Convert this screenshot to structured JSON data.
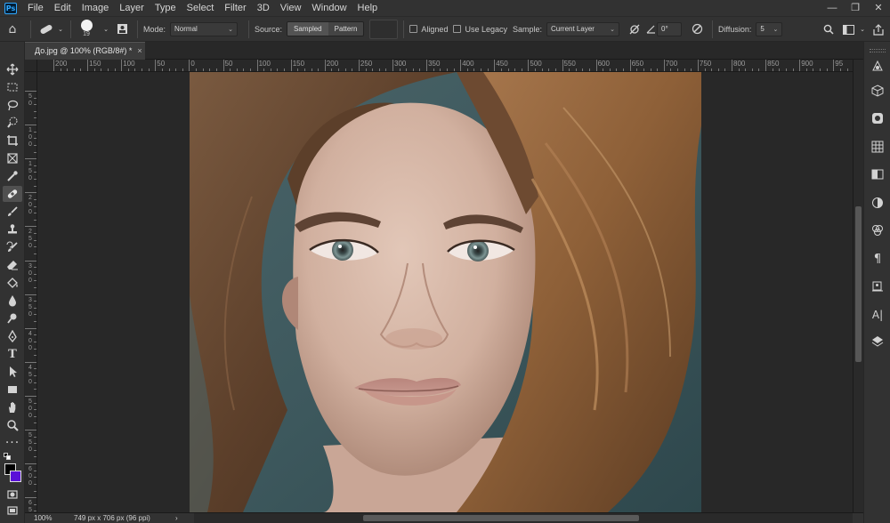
{
  "app": {
    "logo_text": "Ps"
  },
  "menu": [
    "File",
    "Edit",
    "Image",
    "Layer",
    "Type",
    "Select",
    "Filter",
    "3D",
    "View",
    "Window",
    "Help"
  ],
  "window_controls": {
    "minimize": "—",
    "restore": "❐",
    "close": "✕"
  },
  "options": {
    "brush_size": "19",
    "mode_label": "Mode:",
    "mode_value": "Normal",
    "source_label": "Source:",
    "source_sampled": "Sampled",
    "source_pattern": "Pattern",
    "aligned_label": "Aligned",
    "legacy_label": "Use Legacy",
    "sample_label": "Sample:",
    "sample_value": "Current Layer",
    "angle_value": "0°",
    "diffusion_label": "Diffusion:",
    "diffusion_value": "5"
  },
  "document_tab": {
    "title": "До.jpg @ 100% (RGB/8#) *",
    "close": "×"
  },
  "ruler_h": [
    "200",
    "150",
    "100",
    "50",
    "0",
    "50",
    "100",
    "150",
    "200",
    "250",
    "300",
    "350",
    "400",
    "450",
    "500",
    "550",
    "600",
    "650",
    "700",
    "750",
    "800",
    "850",
    "900",
    "95"
  ],
  "ruler_v": [
    "5 0",
    "1 0 0",
    "1 5 0",
    "2 0 0",
    "2 5 0",
    "3 0 0",
    "3 5 0",
    "4 0 0",
    "4 5 0",
    "5 0 0",
    "5 5 0",
    "6 0 0",
    "6 5"
  ],
  "status": {
    "zoom": "100%",
    "doc_info": "749 px x 706 px (96 ppi)",
    "arrow": "›"
  },
  "tools": [
    "move-icon",
    "marquee-icon",
    "lasso-icon",
    "quick-select-icon",
    "crop-icon",
    "frame-icon",
    "eyedropper-icon",
    "healing-brush-icon",
    "brush-icon",
    "clone-stamp-icon",
    "history-brush-icon",
    "eraser-icon",
    "paint-bucket-icon",
    "blur-icon",
    "dodge-icon",
    "pen-icon",
    "type-icon",
    "path-select-icon",
    "rectangle-icon",
    "hand-icon",
    "zoom-icon",
    "more-icon"
  ],
  "colors": {
    "foreground": "#000000",
    "background": "#5a10d8",
    "chrome": "#323232",
    "canvas_bg": "#282828"
  }
}
